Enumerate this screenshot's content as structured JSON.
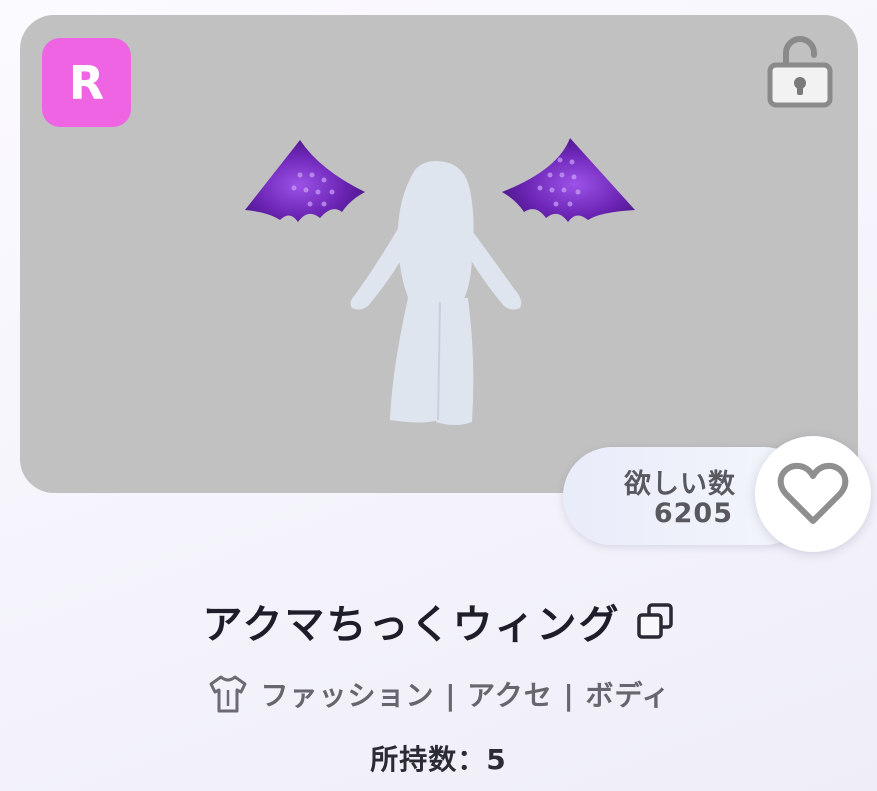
{
  "item": {
    "rarity": "R",
    "title": "アクマちっくウィング",
    "category": "ファッション | アクセ | ボディ",
    "owned_label": "所持数：",
    "owned_count": "5"
  },
  "wishlist": {
    "label": "欲しい数",
    "count": "6205"
  },
  "icons": {
    "lock": "unlocked-padlock-icon",
    "heart": "heart-outline-icon",
    "copy": "copy-icon",
    "category": "shirt-icon"
  },
  "colors": {
    "rarity_badge": "#ee64e2",
    "image_background": "#c1c1c1",
    "wing_purple": "#7a2fc8"
  }
}
